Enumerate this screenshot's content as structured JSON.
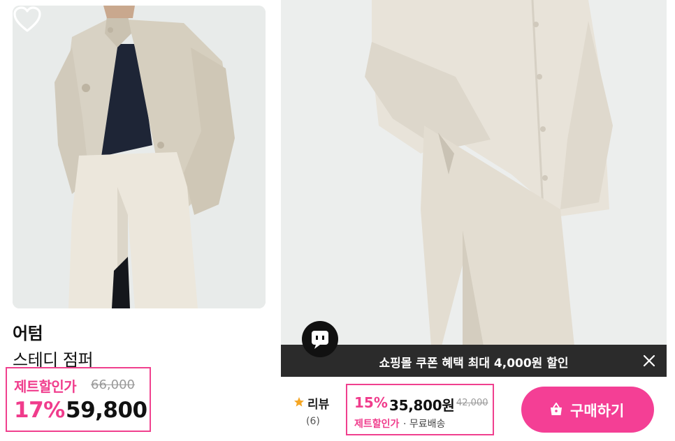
{
  "left_card": {
    "brand": "어텀",
    "product_name": "스테디 점퍼",
    "discount_label": "제트할인가",
    "original_price": "66,000",
    "discount_percent": "17%",
    "sale_price": "59,800",
    "heart_icon": "heart-outline-icon"
  },
  "right_pane": {
    "chat_icon": "chat-bot-icon",
    "coupon_banner": {
      "text": "쇼핑몰 쿠폰 혜택 최대 4,000원 할인",
      "close_icon": "close-icon"
    },
    "review": {
      "label": "리뷰",
      "count": "(6)",
      "icon": "star-icon"
    },
    "price": {
      "discount_percent": "15%",
      "sale_price": "35,800원",
      "original_price": "42,000",
      "discount_label": "제트할인가",
      "shipping": "· 무료배송"
    },
    "buy_button": {
      "label": "구매하기",
      "icon": "shopping-bag-icon"
    }
  },
  "colors": {
    "accent_pink": "#f43f95",
    "highlight_border": "#f0408e",
    "banner_dark": "#2b2b2b",
    "star_orange": "#f5a623"
  }
}
